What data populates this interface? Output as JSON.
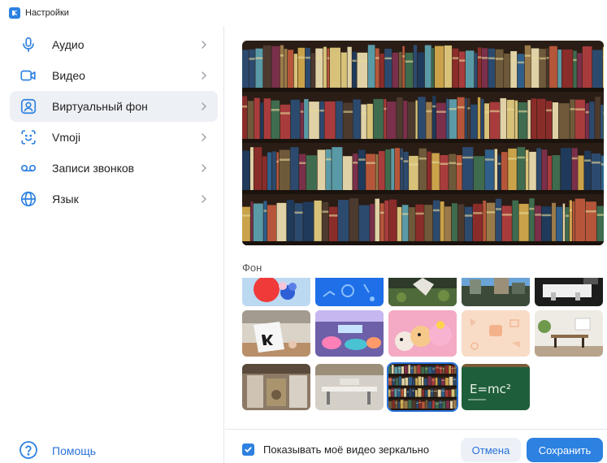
{
  "window": {
    "title": "Настройки",
    "icon": "app-logo-icon"
  },
  "sidebar": {
    "items": [
      {
        "label": "Аудио",
        "icon": "microphone-icon"
      },
      {
        "label": "Видео",
        "icon": "video-camera-icon"
      },
      {
        "label": "Виртуальный фон",
        "icon": "portrait-icon",
        "active": true
      },
      {
        "label": "Vmoji",
        "icon": "smiley-icon"
      },
      {
        "label": "Записи звонков",
        "icon": "recording-icon"
      },
      {
        "label": "Язык",
        "icon": "globe-icon"
      }
    ],
    "help": {
      "label": "Помощь",
      "icon": "question-icon"
    }
  },
  "main": {
    "section_label": "Фон",
    "selected_background": "bookshelf-library"
  },
  "footer": {
    "mirror_checkbox": {
      "label": "Показывать моё видео зеркально",
      "checked": true
    },
    "cancel_label": "Отмена",
    "save_label": "Сохранить"
  },
  "colors": {
    "accent": "#2d81e0",
    "link": "#2a73d9",
    "active_bg": "#edf0f4"
  }
}
